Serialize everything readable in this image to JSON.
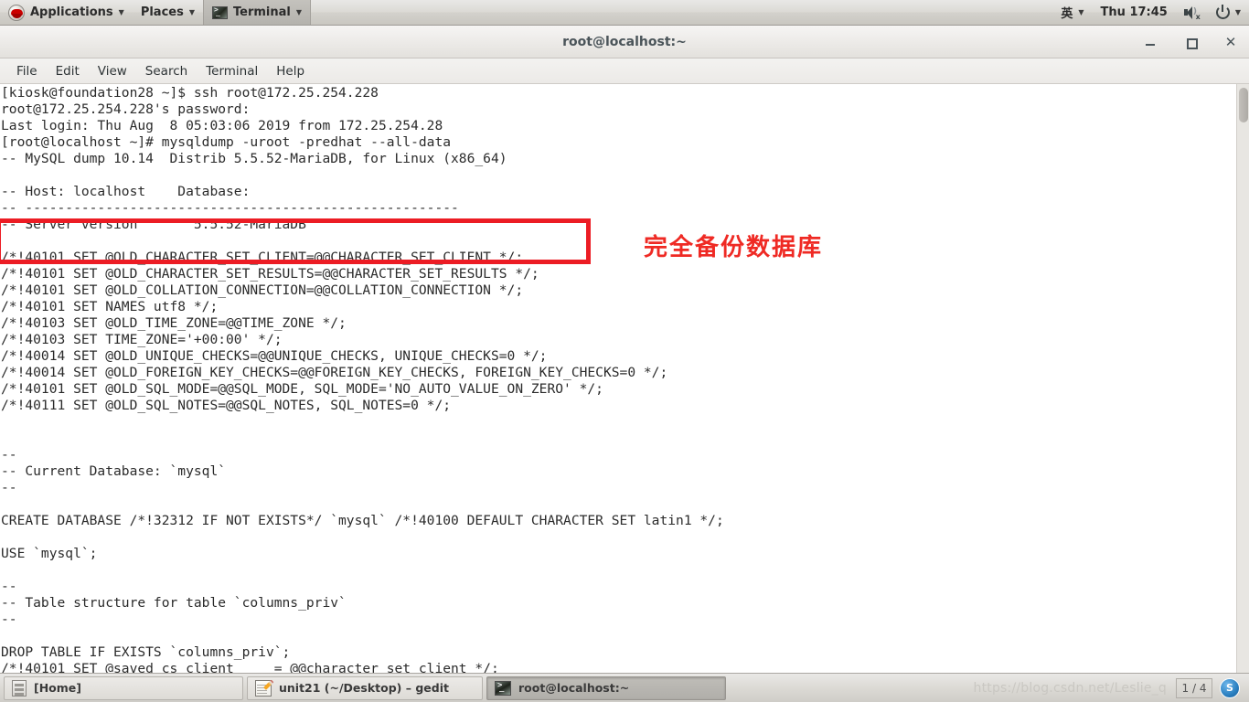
{
  "top_panel": {
    "logo_icon": "redhat-logo-icon",
    "applications_label": "Applications",
    "places_label": "Places",
    "active_app_label": "Terminal",
    "caret": "▼",
    "input_method": "英",
    "clock": "Thu 17:45",
    "volume_icon": "speaker-muted-icon",
    "power_icon": "power-icon"
  },
  "window": {
    "title": "root@localhost:~",
    "minimize_label": "",
    "maximize_label": "",
    "close_label": "✕",
    "menu": [
      "File",
      "Edit",
      "View",
      "Search",
      "Terminal",
      "Help"
    ]
  },
  "terminal": {
    "lines": [
      "[kiosk@foundation28 ~]$ ssh root@172.25.254.228",
      "root@172.25.254.228's password:",
      "Last login: Thu Aug  8 05:03:06 2019 from 172.25.254.28",
      "[root@localhost ~]# mysqldump -uroot -predhat --all-data",
      "-- MySQL dump 10.14  Distrib 5.5.52-MariaDB, for Linux (x86_64)",
      "",
      "-- Host: localhost    Database:",
      "-- ------------------------------------------------------",
      "-- Server version       5.5.52-MariaDB",
      "",
      "/*!40101 SET @OLD_CHARACTER_SET_CLIENT=@@CHARACTER_SET_CLIENT */;",
      "/*!40101 SET @OLD_CHARACTER_SET_RESULTS=@@CHARACTER_SET_RESULTS */;",
      "/*!40101 SET @OLD_COLLATION_CONNECTION=@@COLLATION_CONNECTION */;",
      "/*!40101 SET NAMES utf8 */;",
      "/*!40103 SET @OLD_TIME_ZONE=@@TIME_ZONE */;",
      "/*!40103 SET TIME_ZONE='+00:00' */;",
      "/*!40014 SET @OLD_UNIQUE_CHECKS=@@UNIQUE_CHECKS, UNIQUE_CHECKS=0 */;",
      "/*!40014 SET @OLD_FOREIGN_KEY_CHECKS=@@FOREIGN_KEY_CHECKS, FOREIGN_KEY_CHECKS=0 */;",
      "/*!40101 SET @OLD_SQL_MODE=@@SQL_MODE, SQL_MODE='NO_AUTO_VALUE_ON_ZERO' */;",
      "/*!40111 SET @OLD_SQL_NOTES=@@SQL_NOTES, SQL_NOTES=0 */;",
      "",
      "",
      "--",
      "-- Current Database: `mysql`",
      "--",
      "",
      "CREATE DATABASE /*!32312 IF NOT EXISTS*/ `mysql` /*!40100 DEFAULT CHARACTER SET latin1 */;",
      "",
      "USE `mysql`;",
      "",
      "--",
      "-- Table structure for table `columns_priv`",
      "--",
      "",
      "DROP TABLE IF EXISTS `columns_priv`;",
      "/*!40101 SET @saved_cs_client     = @@character_set_client */;"
    ]
  },
  "annotation": {
    "label": "完全备份数据库",
    "color": "#ef2a24",
    "box_color": "#ec1c24"
  },
  "taskbar": {
    "items": [
      {
        "label": "[Home]",
        "icon": "file-manager-icon",
        "active": false
      },
      {
        "label": "unit21 (~/Desktop) – gedit",
        "icon": "gedit-icon",
        "active": false
      },
      {
        "label": "root@localhost:~",
        "icon": "terminal-icon",
        "active": true
      }
    ],
    "watermark": "https://blog.csdn.net/Leslie_q",
    "workspace": "1 / 4",
    "badge": "S"
  }
}
